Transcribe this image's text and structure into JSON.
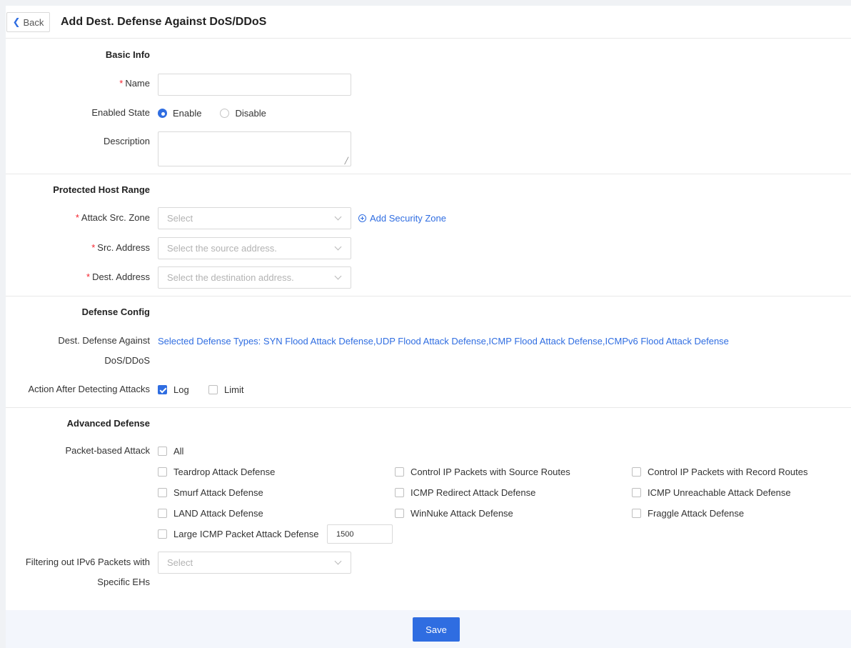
{
  "header": {
    "back_label": "Back",
    "title": "Add Dest. Defense Against DoS/DDoS"
  },
  "basic_info": {
    "section": "Basic Info",
    "name_label": "Name",
    "name_value": "",
    "enabled_label": "Enabled State",
    "enable_option": "Enable",
    "disable_option": "Disable",
    "selected": "Enable",
    "description_label": "Description",
    "description_value": ""
  },
  "host_range": {
    "section": "Protected Host Range",
    "src_zone_label": "Attack Src. Zone",
    "src_zone_placeholder": "Select",
    "add_zone_link": "Add Security Zone",
    "src_addr_label": "Src. Address",
    "src_addr_placeholder": "Select the source address.",
    "dest_addr_label": "Dest. Address",
    "dest_addr_placeholder": "Select the destination address."
  },
  "defense_config": {
    "section": "Defense Config",
    "dest_defense_label_line1": "Dest. Defense Against",
    "dest_defense_label_line2": "DoS/DDoS",
    "selected_types_link": "Selected Defense Types: SYN Flood Attack Defense,UDP Flood Attack Defense,ICMP Flood Attack Defense,ICMPv6 Flood Attack Defense",
    "action_label": "Action After Detecting Attacks",
    "log_label": "Log",
    "log_checked": true,
    "limit_label": "Limit",
    "limit_checked": false
  },
  "advanced": {
    "section": "Advanced Defense",
    "packet_label": "Packet-based Attack",
    "all_label": "All",
    "options": [
      {
        "label": "Teardrop Attack Defense",
        "checked": false
      },
      {
        "label": "Control IP Packets with Source Routes",
        "checked": false
      },
      {
        "label": "Control IP Packets with Record Routes",
        "checked": false
      },
      {
        "label": "Smurf Attack Defense",
        "checked": false
      },
      {
        "label": "ICMP Redirect Attack Defense",
        "checked": false
      },
      {
        "label": "ICMP Unreachable Attack Defense",
        "checked": false
      },
      {
        "label": "LAND Attack Defense",
        "checked": false
      },
      {
        "label": "WinNuke Attack Defense",
        "checked": false
      },
      {
        "label": "Fraggle Attack Defense",
        "checked": false
      },
      {
        "label": "Large ICMP Packet Attack Defense",
        "checked": false
      }
    ],
    "large_icmp_value": "1500",
    "ipv6_label_line1": "Filtering out IPv6 Packets with",
    "ipv6_label_line2": "Specific EHs",
    "ipv6_placeholder": "Select"
  },
  "footer": {
    "save_label": "Save"
  },
  "colors": {
    "accent": "#2f6de1",
    "required": "#f5222d"
  }
}
